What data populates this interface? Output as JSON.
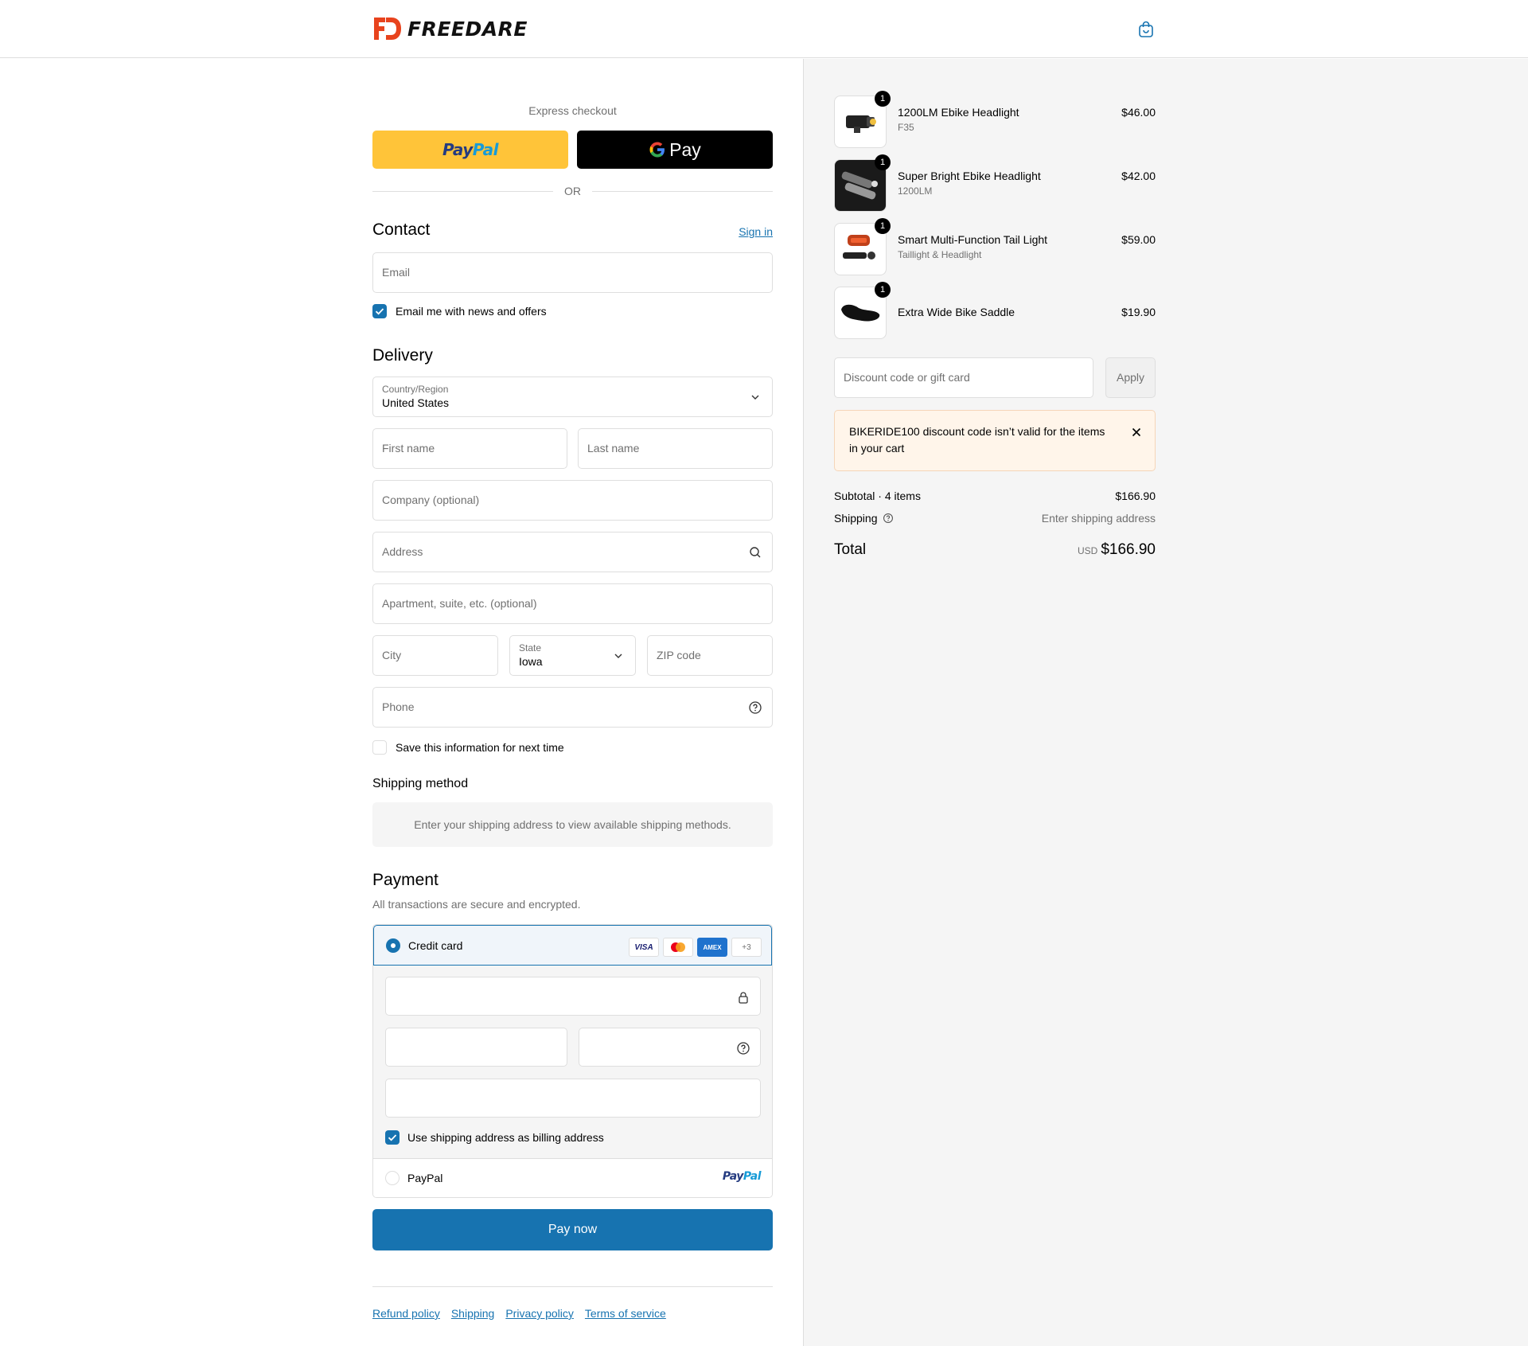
{
  "brand": {
    "name": "FREEDARE",
    "accent": "#1773b0",
    "logo_color": "#e8431d"
  },
  "express": {
    "title": "Express checkout",
    "paypal_part1": "Pay",
    "paypal_part2": "Pal",
    "gpay_label": "Pay",
    "or_label": "OR"
  },
  "contact": {
    "heading": "Contact",
    "sign_in": "Sign in",
    "email_placeholder": "Email",
    "news_label": "Email me with news and offers",
    "news_checked": true
  },
  "delivery": {
    "heading": "Delivery",
    "country_label": "Country/Region",
    "country_value": "United States",
    "first_name": "First name",
    "last_name": "Last name",
    "company": "Company (optional)",
    "address": "Address",
    "apartment": "Apartment, suite, etc. (optional)",
    "city": "City",
    "state_label": "State",
    "state_value": "Iowa",
    "zip": "ZIP code",
    "phone": "Phone",
    "save_label": "Save this information for next time",
    "save_checked": false
  },
  "shipping_method": {
    "heading": "Shipping method",
    "message": "Enter your shipping address to view available shipping methods."
  },
  "payment": {
    "heading": "Payment",
    "subtitle": "All transactions are secure and encrypted.",
    "credit_card_label": "Credit card",
    "cards": [
      "VISA",
      "AMEX",
      "+3"
    ],
    "billing_label": "Use shipping address as billing address",
    "billing_checked": true,
    "paypal_label": "PayPal",
    "paypal_logo_1": "Pay",
    "paypal_logo_2": "Pal",
    "pay_button": "Pay now"
  },
  "footer": {
    "links": [
      "Refund policy",
      "Shipping",
      "Privacy policy",
      "Terms of service"
    ]
  },
  "cart": {
    "items": [
      {
        "name": "1200LM Ebike Headlight",
        "variant": "F35",
        "price": "$46.00",
        "qty": "1"
      },
      {
        "name": "Super Bright Ebike Headlight",
        "variant": "1200LM",
        "price": "$42.00",
        "qty": "1"
      },
      {
        "name": "Smart Multi-Function Tail Light",
        "variant": "Taillight & Headlight",
        "price": "$59.00",
        "qty": "1"
      },
      {
        "name": "Extra Wide Bike Saddle",
        "variant": "",
        "price": "$19.90",
        "qty": "1"
      }
    ],
    "discount_placeholder": "Discount code or gift card",
    "apply_label": "Apply",
    "alert_message": "BIKERIDE100 discount code isn’t valid for the items in your cart",
    "subtotal_label": "Subtotal · 4 items",
    "subtotal_value": "$166.90",
    "shipping_label": "Shipping",
    "shipping_value": "Enter shipping address",
    "total_label": "Total",
    "total_currency": "USD",
    "total_value": "$166.90"
  }
}
